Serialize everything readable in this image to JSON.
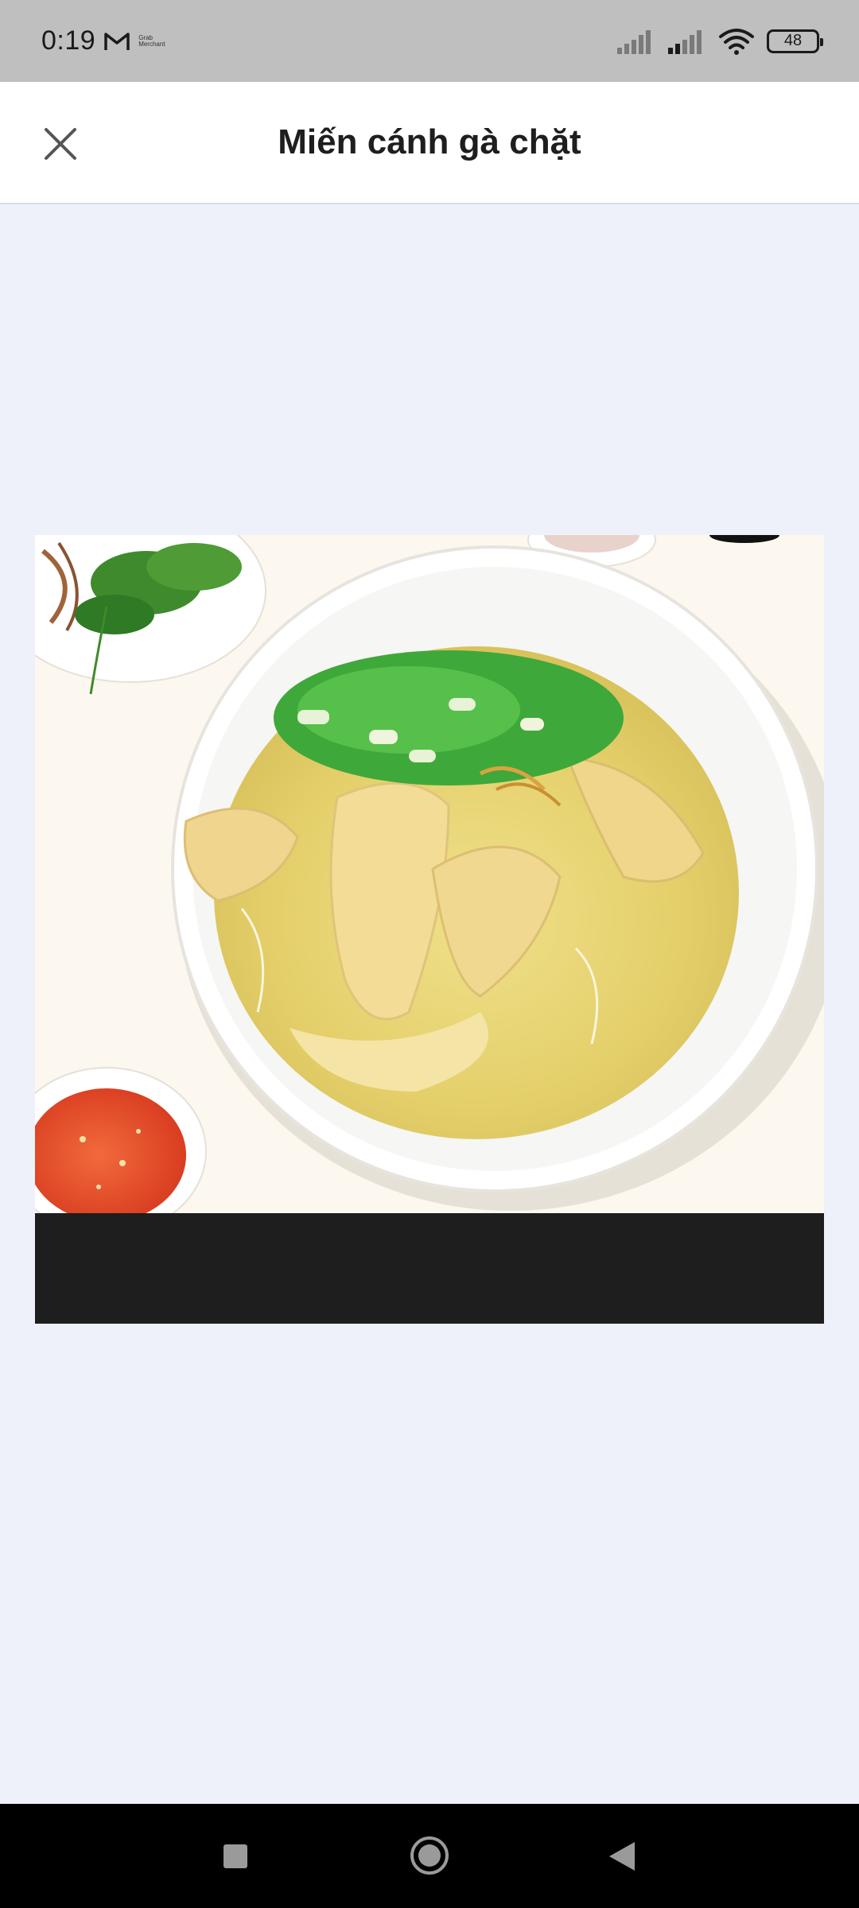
{
  "status_bar": {
    "time": "0:19",
    "mail_app_icon": "gmail-icon",
    "notification_text": "Grab Merchant",
    "battery_level": "48",
    "signal_icons": [
      "signal-1-icon",
      "signal-2-icon"
    ],
    "wifi_icon": "wifi-icon"
  },
  "header": {
    "title": "Miến cánh gà chặt",
    "close_icon": "close-icon"
  },
  "image": {
    "subject": "chicken-noodle-soup-photo"
  },
  "nav_bar": {
    "recents_icon": "square-icon",
    "home_icon": "circle-icon",
    "back_icon": "triangle-back-icon"
  },
  "colors": {
    "status_bar_bg": "#bfbfbf",
    "header_bg": "#ffffff",
    "content_bg": "#eef1fa",
    "caption_bar_bg": "#1e1e1e",
    "nav_bg": "#000000"
  }
}
